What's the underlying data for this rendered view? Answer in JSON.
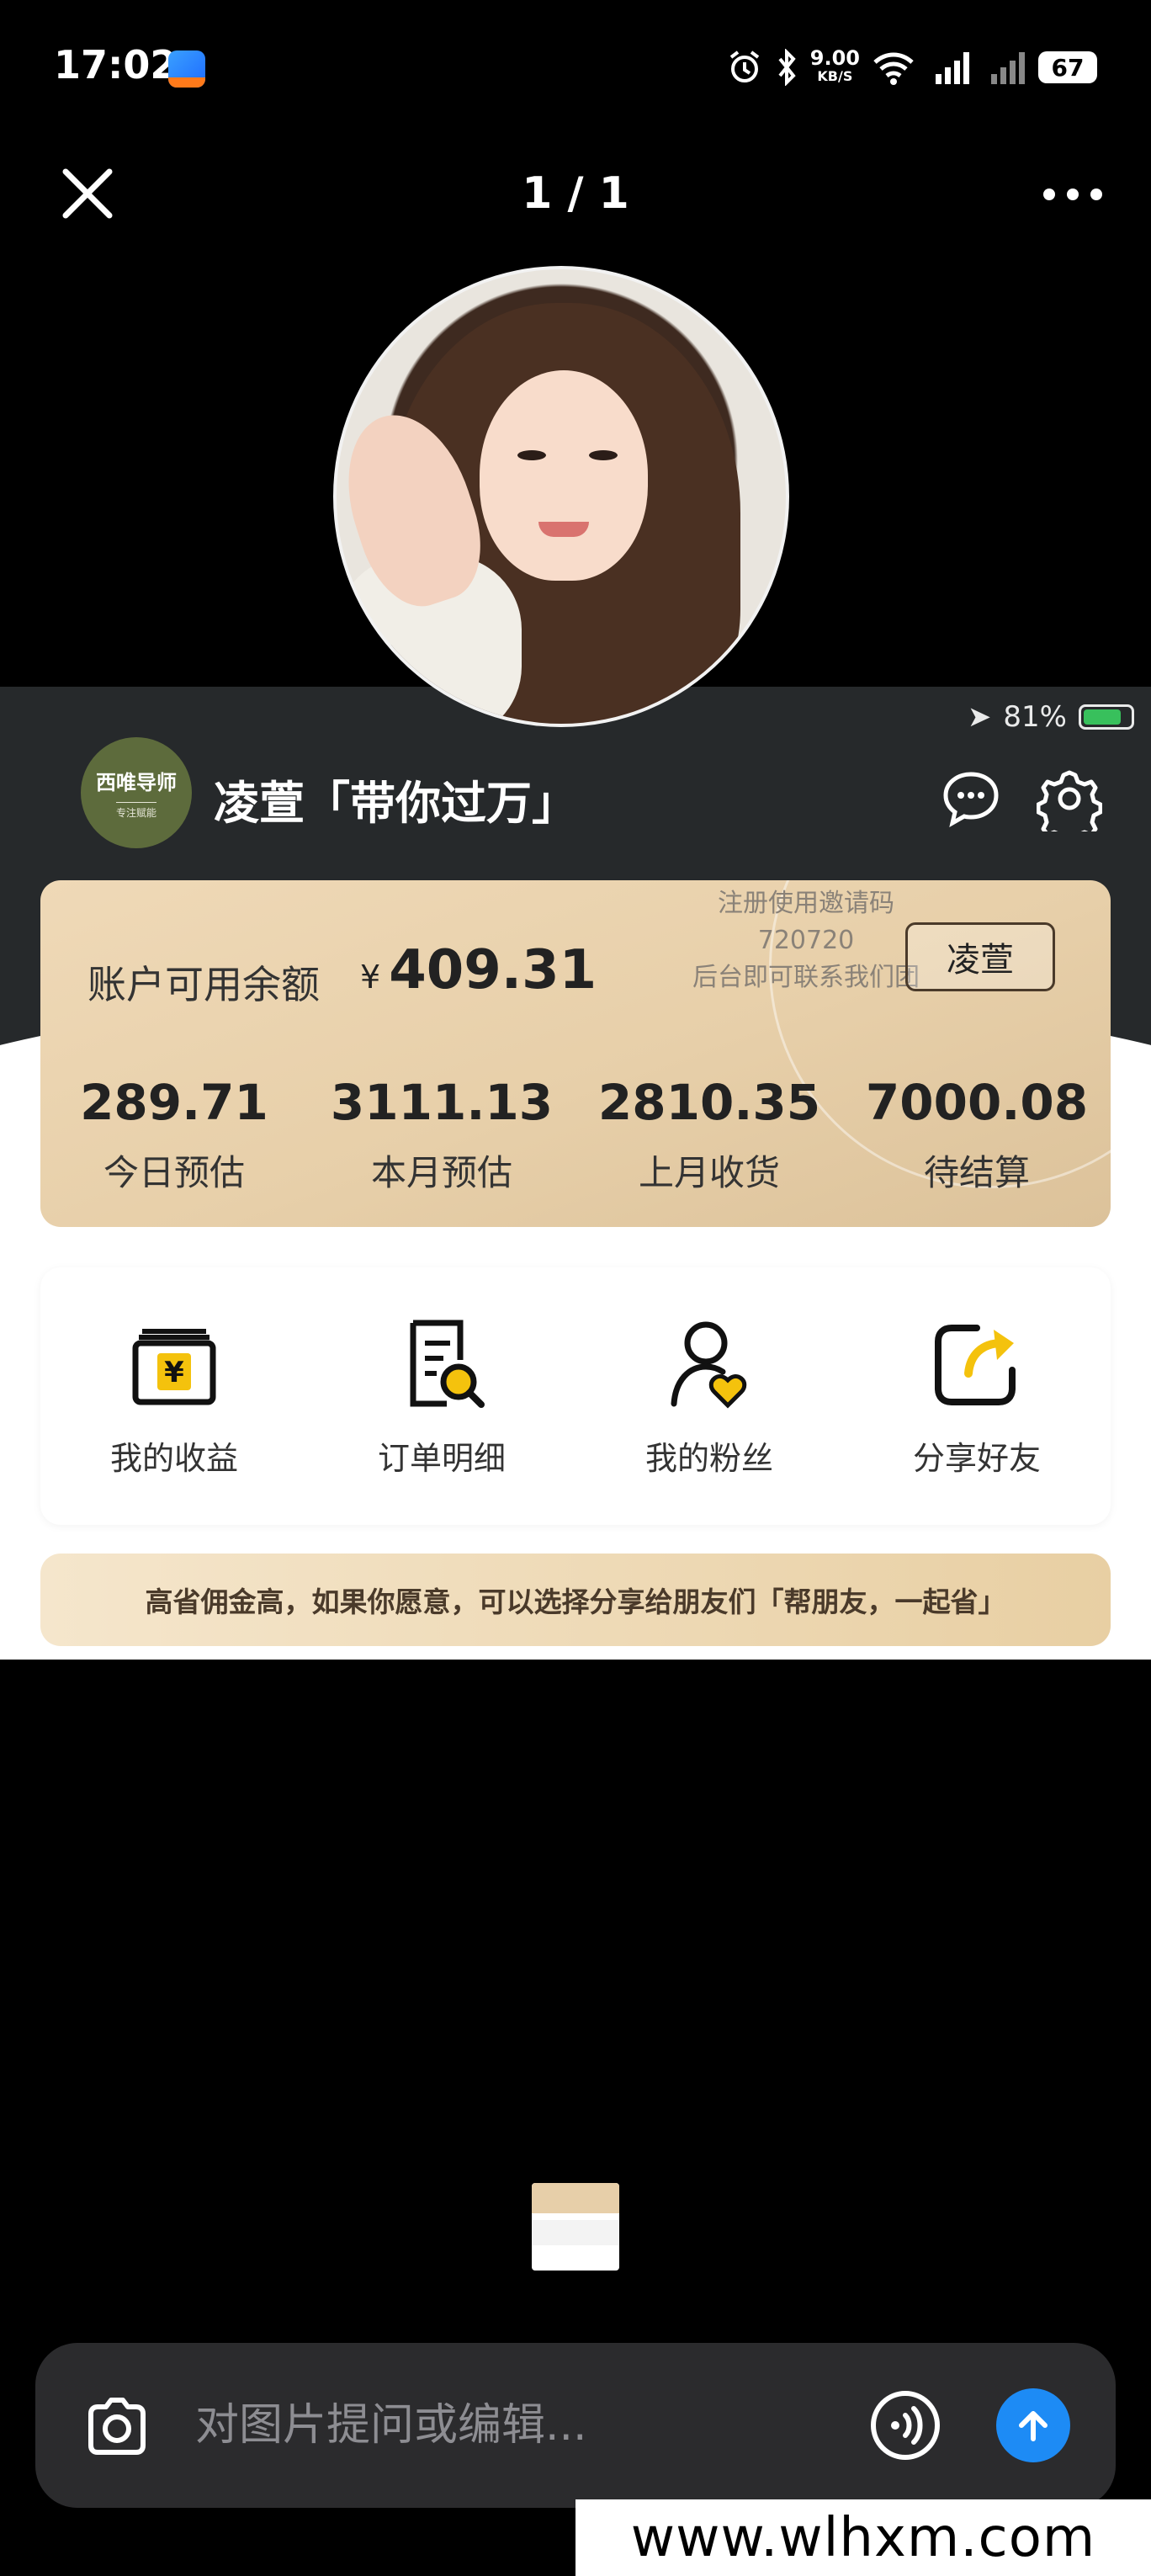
{
  "status_bar": {
    "time": "17:02",
    "net_speed_value": "9.00",
    "net_speed_unit": "KB/S",
    "battery": "67"
  },
  "viewer": {
    "counter": "1 / 1"
  },
  "image": {
    "inner_status": {
      "battery_percent": "81%"
    },
    "brand_logo": {
      "line1": "西唯导师",
      "line2": "专注赋能"
    },
    "username": "凌萱「带你过万」",
    "balance": {
      "label": "账户可用余额",
      "currency": "¥",
      "value": "409.31"
    },
    "promo": {
      "line1": "注册使用邀请码",
      "line2": "720720",
      "line3": "后台即可联系我们团",
      "button": "凌萱"
    },
    "stats": [
      {
        "value": "289.71",
        "label": "今日预估"
      },
      {
        "value": "3111.13",
        "label": "本月预估"
      },
      {
        "value": "2810.35",
        "label": "上月收货"
      },
      {
        "value": "7000.08",
        "label": "待结算"
      }
    ],
    "menu": [
      {
        "label": "我的收益",
        "icon": "wallet-yen-icon"
      },
      {
        "label": "订单明细",
        "icon": "order-search-icon"
      },
      {
        "label": "我的粉丝",
        "icon": "user-heart-icon"
      },
      {
        "label": "分享好友",
        "icon": "share-arrow-icon"
      }
    ],
    "banner": "高省佣金高，如果你愿意，可以选择分享给朋友们「帮朋友，一起省」"
  },
  "input": {
    "placeholder": "对图片提问或编辑..."
  },
  "watermark": "www.wlhxm.com",
  "colors": {
    "gold": "#e7cfa9",
    "accent_yellow": "#f4c20d",
    "send_blue": "#1d8bf5"
  }
}
